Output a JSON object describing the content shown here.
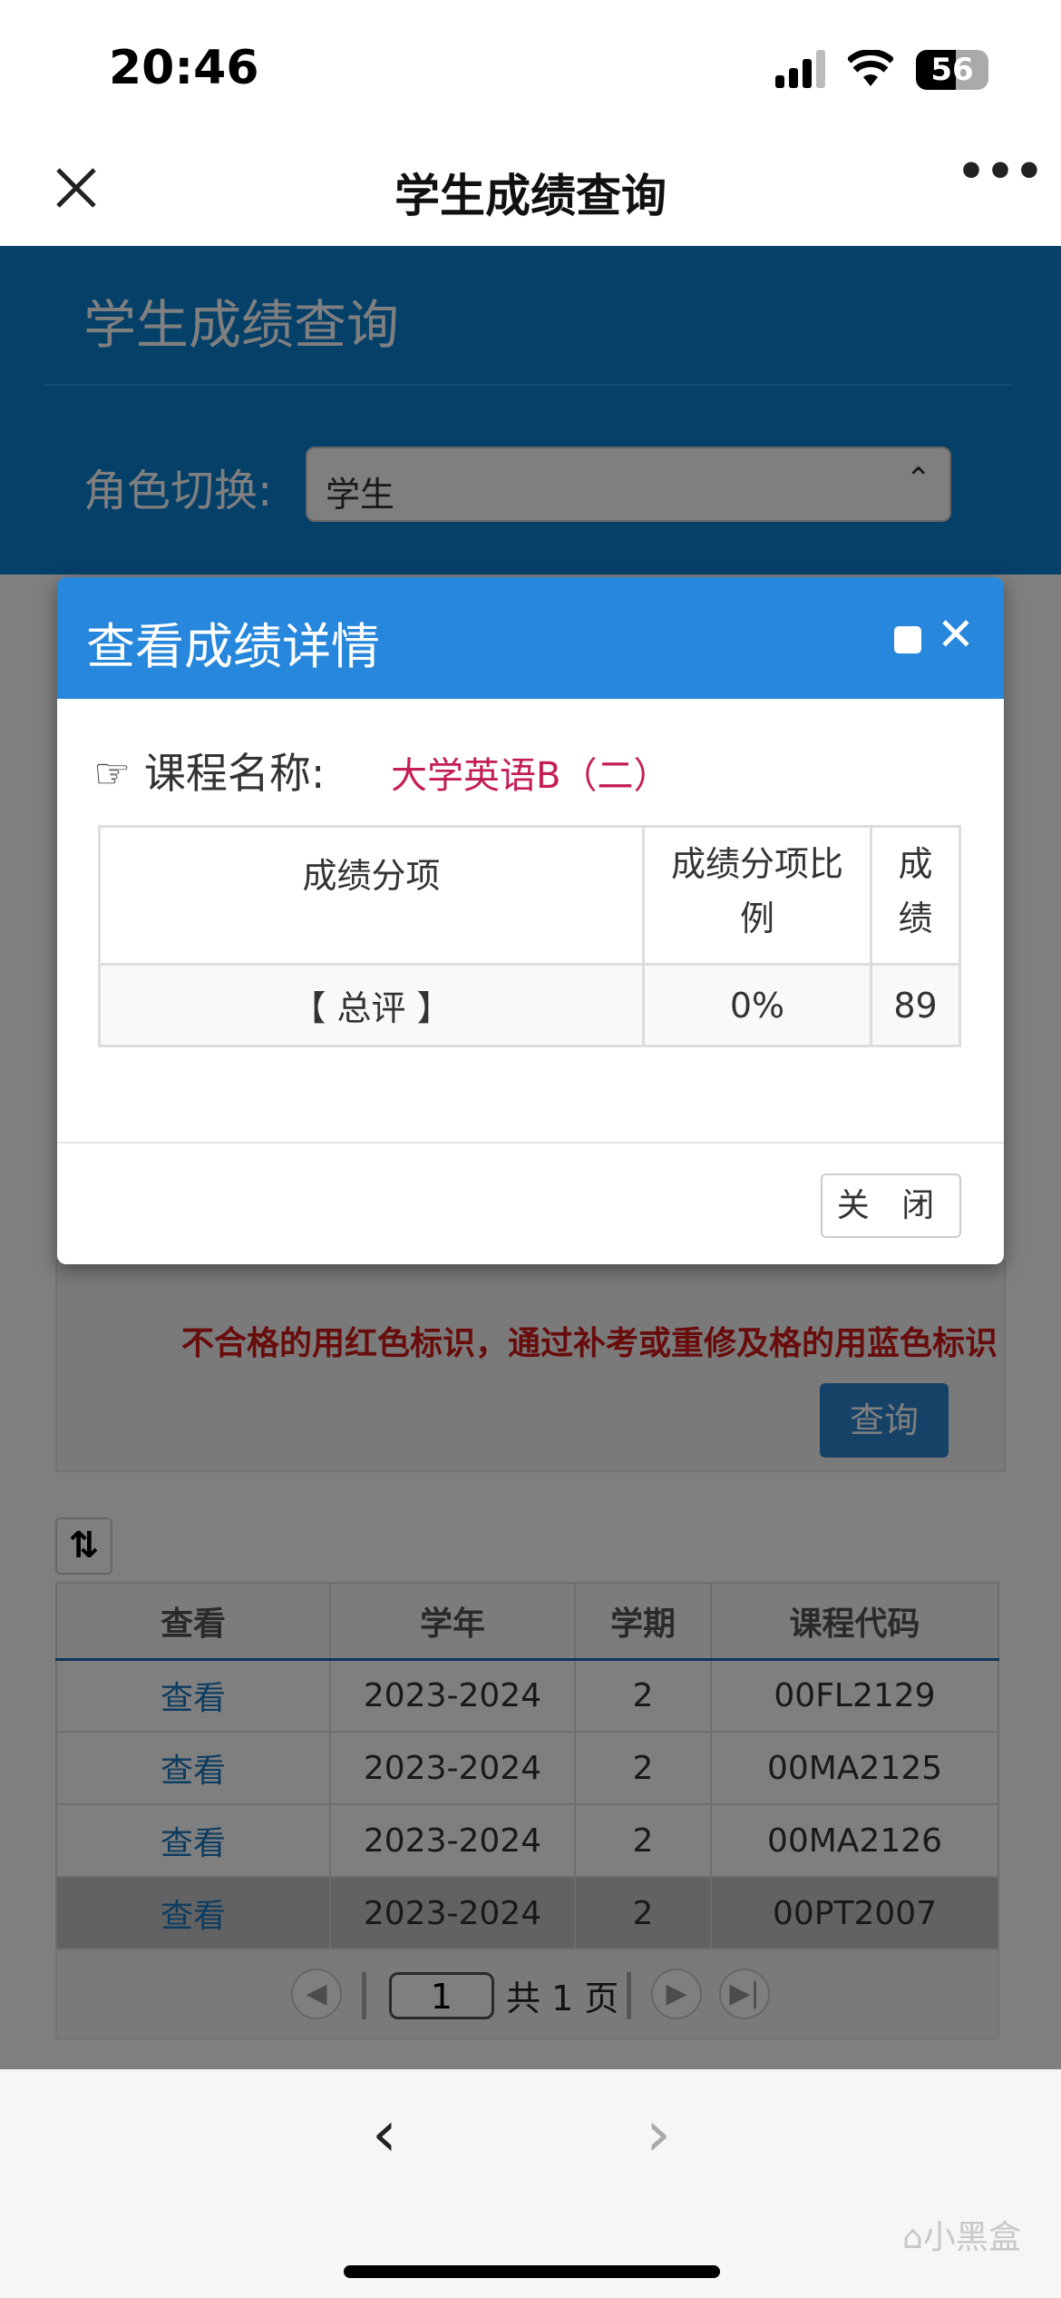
{
  "status_bar": {
    "time": "20:46",
    "battery": "56"
  },
  "navbar": {
    "title": "学生成绩查询",
    "close_icon": "close-icon",
    "more_icon": "more-icon"
  },
  "header": {
    "title": "学生成绩查询",
    "role_label": "角色切换:",
    "role_value": "学生"
  },
  "notice": "不合格的用红色标识，通过补考或重修及格的用蓝色标识",
  "query_button": "查询",
  "table": {
    "headers": [
      "查看",
      "学年",
      "学期",
      "课程代码"
    ],
    "rows": [
      {
        "view": "查看",
        "year": "2023-2024",
        "term": "2",
        "code": "00FL2129"
      },
      {
        "view": "查看",
        "year": "2023-2024",
        "term": "2",
        "code": "00MA2125"
      },
      {
        "view": "查看",
        "year": "2023-2024",
        "term": "2",
        "code": "00MA2126"
      },
      {
        "view": "查看",
        "year": "2023-2024",
        "term": "2",
        "code": "00PT2007"
      }
    ],
    "selected_row": 3
  },
  "pager": {
    "page": "1",
    "total_label": "共 1 页"
  },
  "modal": {
    "title": "查看成绩详情",
    "course_label": "课程名称:",
    "course_name": "大学英语B（二）",
    "headers": [
      "成绩分项",
      "成绩分项比例",
      "成绩"
    ],
    "rows": [
      {
        "item": "【 总评 】",
        "ratio": "0%",
        "score": "89"
      }
    ],
    "close_button": "关 闭"
  },
  "watermark": "小黑盒",
  "colors": {
    "header_blue": "#0a80d2",
    "modal_blue": "#2687dc",
    "course_name": "#c41d56",
    "notice_red": "#d01818"
  }
}
